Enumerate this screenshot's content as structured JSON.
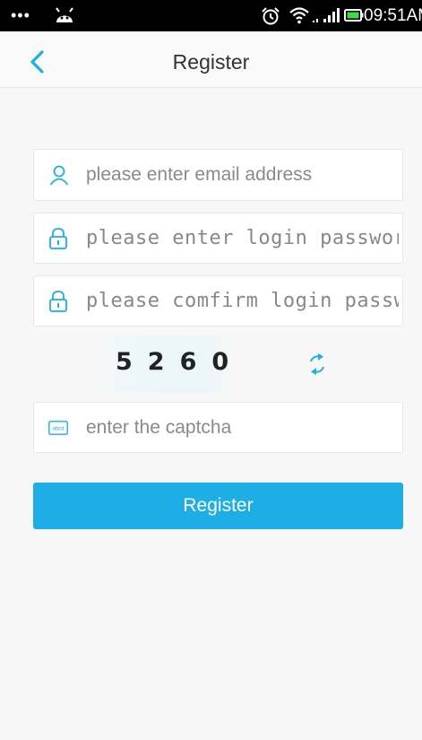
{
  "status_bar": {
    "time": "09:51AM",
    "dots": "•••"
  },
  "nav": {
    "title": "Register",
    "back_icon": "chevron-left-icon"
  },
  "form": {
    "email": {
      "placeholder": "please enter email address",
      "value": ""
    },
    "password": {
      "placeholder": "please enter login password",
      "value": ""
    },
    "confirm_password": {
      "placeholder": "please comfirm login password",
      "value": ""
    },
    "captcha_image_text": "5260",
    "captcha": {
      "placeholder": "enter the captcha",
      "value": "",
      "icon_text": "abcd"
    },
    "submit_label": "Register"
  },
  "colors": {
    "accent": "#1caee5",
    "background": "#f7f7f7",
    "field_border": "#e6e6e6"
  }
}
